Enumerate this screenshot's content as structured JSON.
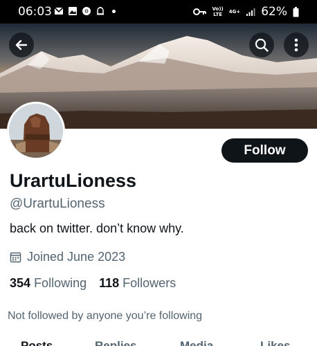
{
  "status_bar": {
    "time": "06:03",
    "battery": "62%",
    "volte_label": "Vo))\nLTE",
    "network_label": "4G+"
  },
  "header": {
    "back_icon": "arrow-left-icon",
    "search_icon": "search-icon",
    "more_icon": "more-vertical-icon"
  },
  "profile": {
    "display_name": "UrartuLioness",
    "handle": "@UrartuLioness",
    "bio": "back on twitter. don’t know why.",
    "joined": "Joined June 2023",
    "following_count": "354",
    "following_label": "Following",
    "followers_count": "118",
    "followers_label": "Followers",
    "not_followed_text": "Not followed by anyone you’re following",
    "follow_button": "Follow"
  },
  "tabs": [
    {
      "label": "Posts",
      "active": true
    },
    {
      "label": "Replies",
      "active": false
    },
    {
      "label": "Media",
      "active": false
    },
    {
      "label": "Likes",
      "active": false
    }
  ],
  "colors": {
    "text_primary": "#0f1419",
    "text_secondary": "#536471",
    "follow_bg": "#0f1419"
  }
}
